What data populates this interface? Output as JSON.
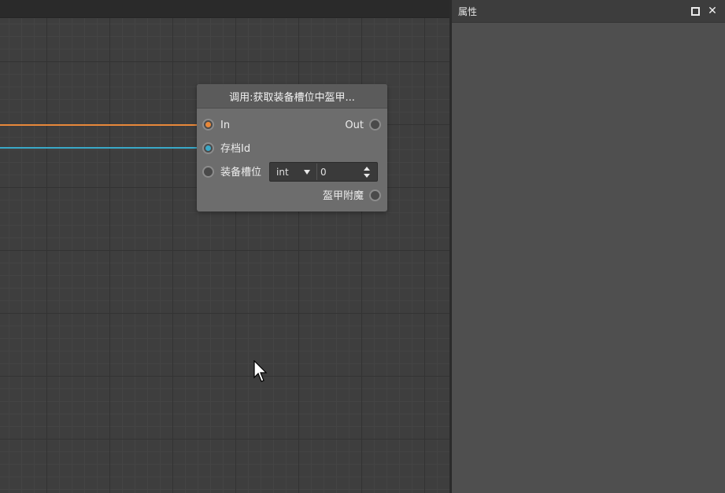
{
  "properties_panel": {
    "title": "属性",
    "maximize_icon": "maximize-icon",
    "close_icon": "close-icon"
  },
  "wires": {
    "exec_color": "#e8883a",
    "data_color": "#3aa9c8"
  },
  "node": {
    "title": "调用:获取装备槽位中盔甲...",
    "pins": {
      "in_label": "In",
      "out_label": "Out",
      "save_id_label": "存档Id",
      "slot_label": "装备槽位",
      "output_label": "盔甲附魔"
    },
    "slot_widget": {
      "type_value": "int",
      "number_value": "0"
    }
  },
  "colors": {
    "exec_pin": "#e8883a",
    "data_pin": "#3aa9c8"
  }
}
